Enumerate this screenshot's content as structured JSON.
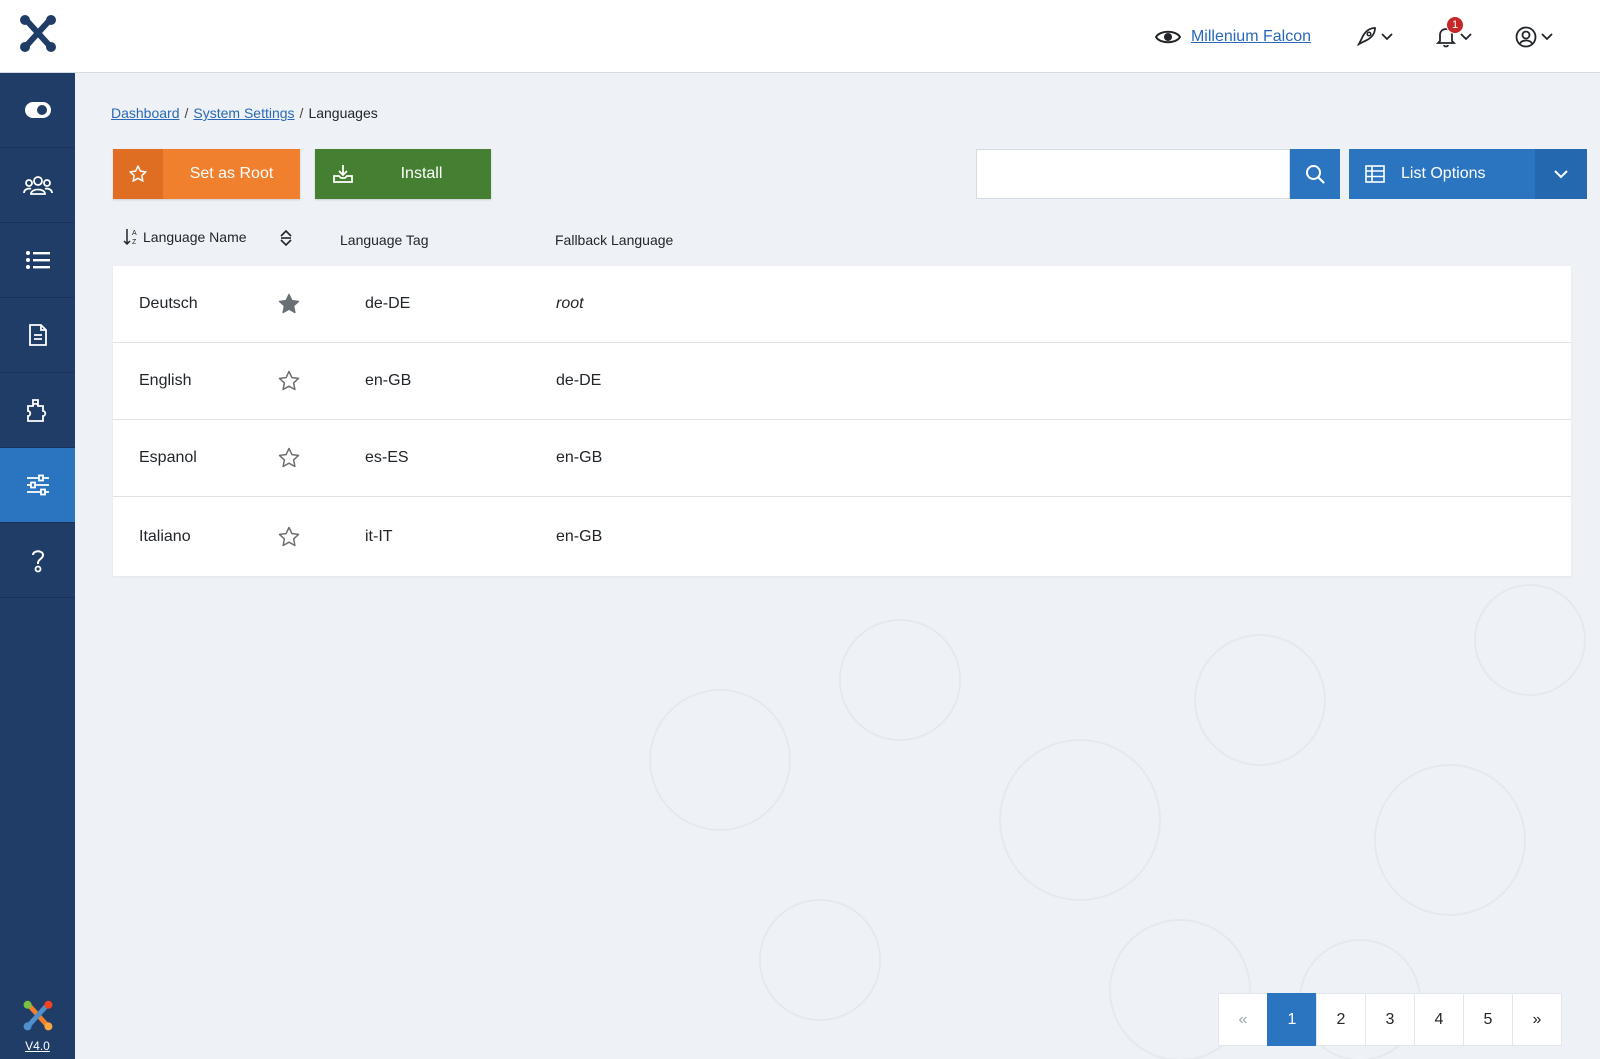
{
  "header": {
    "site_name": "Millenium Falcon",
    "notification_count": "1"
  },
  "sidebar": {
    "items": [
      {
        "icon": "toggle-icon"
      },
      {
        "icon": "users-icon"
      },
      {
        "icon": "list-icon"
      },
      {
        "icon": "document-icon"
      },
      {
        "icon": "puzzle-icon"
      },
      {
        "icon": "sliders-icon",
        "active": true
      },
      {
        "icon": "help-icon"
      }
    ],
    "version": "V4.0"
  },
  "breadcrumb": {
    "items": [
      "Dashboard",
      "System Settings"
    ],
    "current": "Languages"
  },
  "toolbar": {
    "set_root_label": "Set as Root",
    "install_label": "Install",
    "list_options_label": "List Options",
    "search_value": ""
  },
  "table": {
    "columns": [
      "Language Name",
      "Language Tag",
      "Fallback Language"
    ],
    "rows": [
      {
        "name": "Deutsch",
        "default": true,
        "tag": "de-DE",
        "fallback": "root"
      },
      {
        "name": "English",
        "default": false,
        "tag": "en-GB",
        "fallback": "de-DE"
      },
      {
        "name": "Espanol",
        "default": false,
        "tag": "es-ES",
        "fallback": "en-GB"
      },
      {
        "name": "Italiano",
        "default": false,
        "tag": "it-IT",
        "fallback": "en-GB"
      }
    ]
  },
  "pagination": {
    "prev": "«",
    "pages": [
      "1",
      "2",
      "3",
      "4",
      "5"
    ],
    "next": "»",
    "current": "1"
  },
  "colors": {
    "sidebar": "#1f3d66",
    "accent_blue": "#2a74c0",
    "orange": "#f07f2e",
    "green": "#447f32"
  }
}
